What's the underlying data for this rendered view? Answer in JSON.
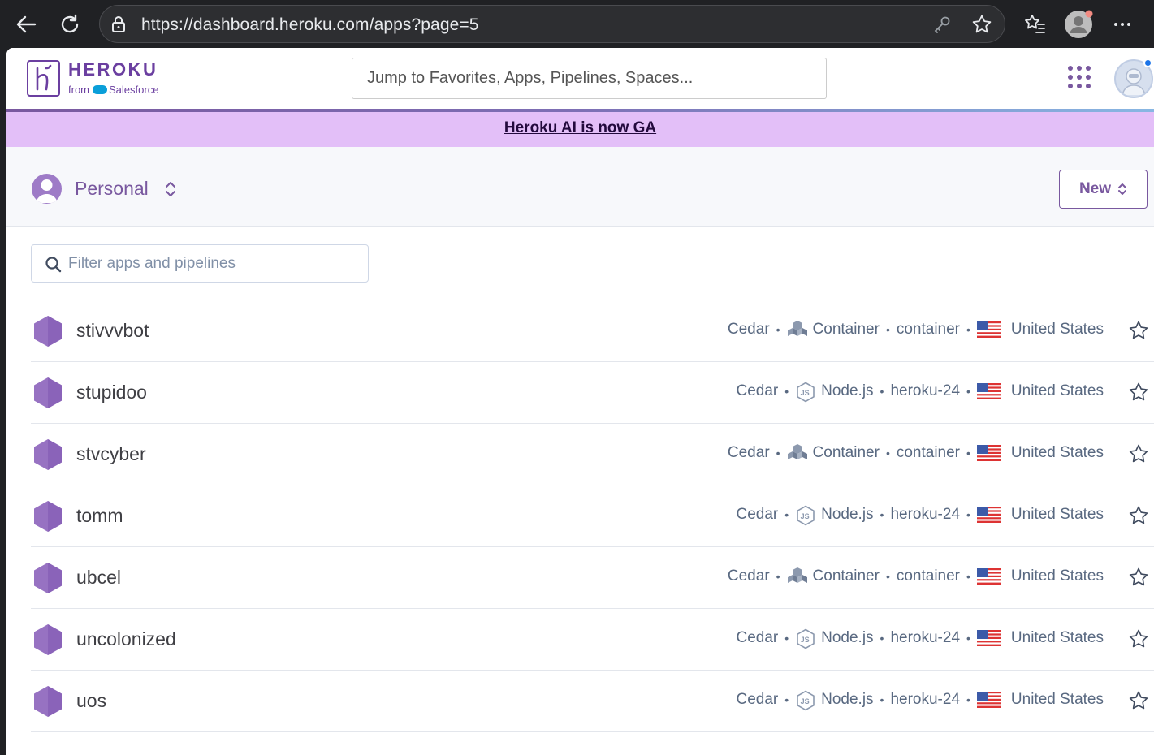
{
  "browser": {
    "url": "https://dashboard.heroku.com/apps?page=5"
  },
  "header": {
    "logo_word": "HEROKU",
    "logo_from": "from",
    "logo_brand": "Salesforce",
    "search_placeholder": "Jump to Favorites, Apps, Pipelines, Spaces..."
  },
  "banner": {
    "text": "Heroku AI is now GA"
  },
  "account": {
    "name": "Personal",
    "new_button": "New"
  },
  "filter": {
    "placeholder": "Filter apps and pipelines"
  },
  "apps": [
    {
      "name": "stivvvbot",
      "stack": "Cedar",
      "buildpack": "Container",
      "buildpack_icon": "container-icon",
      "runtime": "container",
      "region": "United States"
    },
    {
      "name": "stupidoo",
      "stack": "Cedar",
      "buildpack": "Node.js",
      "buildpack_icon": "nodejs-icon",
      "runtime": "heroku-24",
      "region": "United States"
    },
    {
      "name": "stvcyber",
      "stack": "Cedar",
      "buildpack": "Container",
      "buildpack_icon": "container-icon",
      "runtime": "container",
      "region": "United States"
    },
    {
      "name": "tomm",
      "stack": "Cedar",
      "buildpack": "Node.js",
      "buildpack_icon": "nodejs-icon",
      "runtime": "heroku-24",
      "region": "United States"
    },
    {
      "name": "ubcel",
      "stack": "Cedar",
      "buildpack": "Container",
      "buildpack_icon": "container-icon",
      "runtime": "container",
      "region": "United States"
    },
    {
      "name": "uncolonized",
      "stack": "Cedar",
      "buildpack": "Node.js",
      "buildpack_icon": "nodejs-icon",
      "runtime": "heroku-24",
      "region": "United States"
    },
    {
      "name": "uos",
      "stack": "Cedar",
      "buildpack": "Node.js",
      "buildpack_icon": "nodejs-icon",
      "runtime": "heroku-24",
      "region": "United States"
    }
  ],
  "colors": {
    "brand_purple": "#79589f",
    "banner_bg": "#e3bff8",
    "browser_bg": "#202124"
  }
}
